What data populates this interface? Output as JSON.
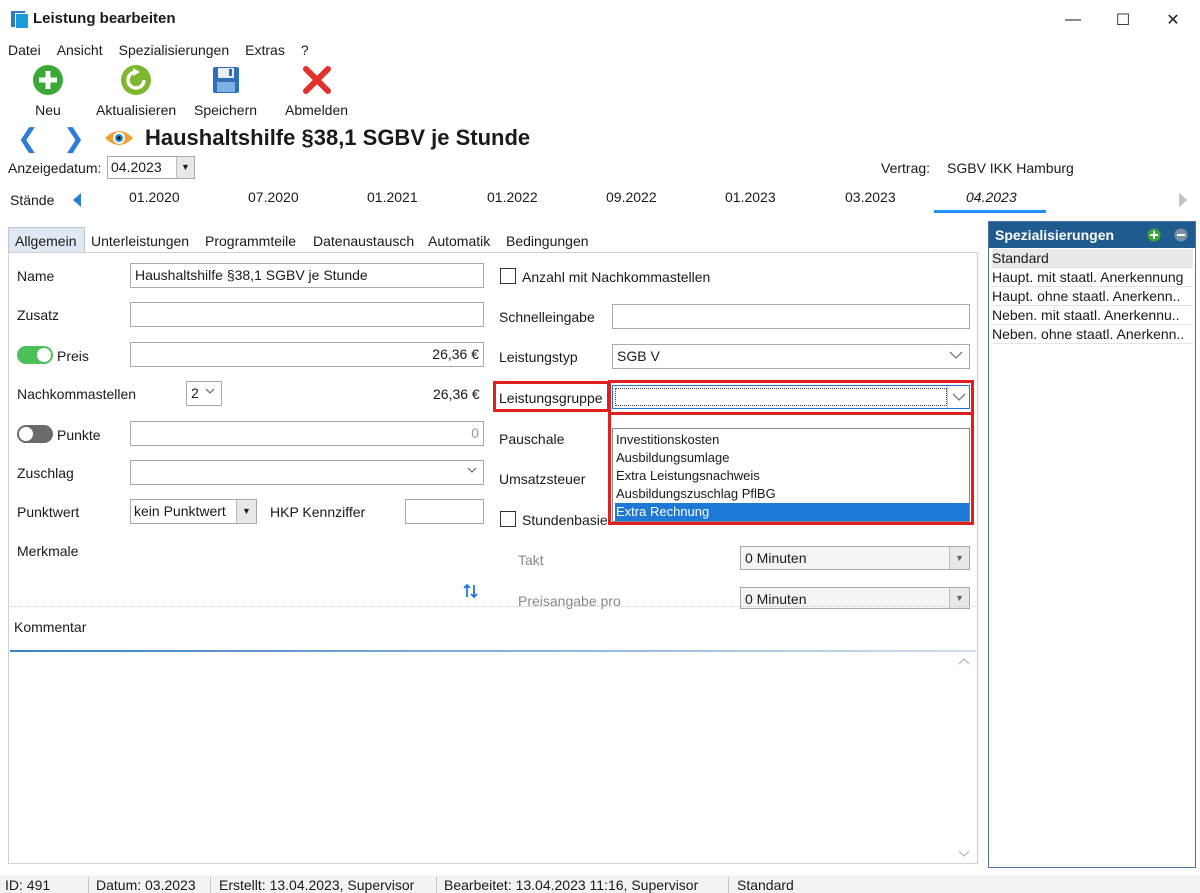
{
  "window": {
    "title": "Leistung bearbeiten",
    "minimize": "—",
    "maximize": "☐",
    "close": "✕"
  },
  "menu": [
    "Datei",
    "Ansicht",
    "Spezialisierungen",
    "Extras",
    "?"
  ],
  "toolbar": {
    "new_label": "Neu",
    "refresh_label": "Aktualisieren",
    "save_label": "Speichern",
    "logout_label": "Abmelden"
  },
  "header": {
    "title": "Haushaltshilfe §38,1 SGBV je Stunde",
    "display_date_label": "Anzeigedatum:",
    "display_date_value": "04.2023",
    "contract_label": "Vertrag:",
    "contract_value": "SGBV IKK Hamburg"
  },
  "staende": {
    "label": "Stände",
    "dates": [
      "01.2020",
      "07.2020",
      "01.2021",
      "01.2022",
      "09.2022",
      "01.2023",
      "03.2023",
      "04.2023"
    ],
    "selected": "04.2023"
  },
  "tabs": [
    "Allgemein",
    "Unterleistungen",
    "Programmteile",
    "Datenaustausch",
    "Automatik",
    "Bedingungen"
  ],
  "form_left": {
    "name_label": "Name",
    "name_value": "Haushaltshilfe §38,1 SGBV je Stunde",
    "zusatz_label": "Zusatz",
    "zusatz_value": "",
    "preis_label": "Preis",
    "preis_value": "26,36 €",
    "preis_enabled": true,
    "nachkomma_label": "Nachkommastellen",
    "nachkomma_value": "2",
    "nachkomma_result": "26,36 €",
    "punkte_label": "Punkte",
    "punkte_value": "0",
    "punkte_enabled": false,
    "zuschlag_label": "Zuschlag",
    "zuschlag_value": "",
    "punktwert_label": "Punktwert",
    "punktwert_value": "kein Punktwert",
    "hkp_label": "HKP Kennziffer",
    "hkp_value": "",
    "merkmale_label": "Merkmale"
  },
  "form_right": {
    "anzahl_label": "Anzahl mit Nachkommastellen",
    "anzahl_checked": false,
    "schnell_label": "Schnelleingabe",
    "schnell_value": "",
    "leistungstyp_label": "Leistungstyp",
    "leistungstyp_value": "SGB V",
    "leistungsgruppe_label": "Leistungsgruppe",
    "leistungsgruppe_value": "",
    "leistungsgruppe_options": [
      "Investitionskosten",
      "Ausbildungsumlage",
      "Extra Leistungsnachweis",
      "Ausbildungszuschlag PflBG",
      "Extra Rechnung"
    ],
    "leistungsgruppe_highlighted": "Extra Rechnung",
    "pauschale_label": "Pauschale",
    "umsatzsteuer_label": "Umsatzsteuer",
    "stundenbasiert_label": "Stundenbasie",
    "stundenbasiert_checked": false,
    "takt_label": "Takt",
    "takt_value": "0 Minuten",
    "preisangabe_label": "Preisangabe pro",
    "preisangabe_value": "0 Minuten"
  },
  "comment": {
    "label": "Kommentar"
  },
  "specializations": {
    "title": "Spezialisierungen",
    "items": [
      "Standard",
      "Haupt. mit staatl. Anerkennung",
      "Haupt. ohne staatl. Anerkenn..",
      "Neben. mit staatl. Anerkennu..",
      "Neben. ohne staatl. Anerkenn.."
    ]
  },
  "status": {
    "id": "ID: 491",
    "datum": "Datum: 03.2023",
    "erstellt": "Erstellt: 13.04.2023, Supervisor",
    "bearbeitet": "Bearbeitet: 13.04.2023 11:16, Supervisor",
    "variant": "Standard"
  },
  "colors": {
    "accent_blue": "#1e78d7",
    "toggle_on": "#4cc159",
    "toggle_off": "#6b6b6b",
    "highlight_red": "#e02020",
    "panel_header": "#1f5b8f"
  }
}
